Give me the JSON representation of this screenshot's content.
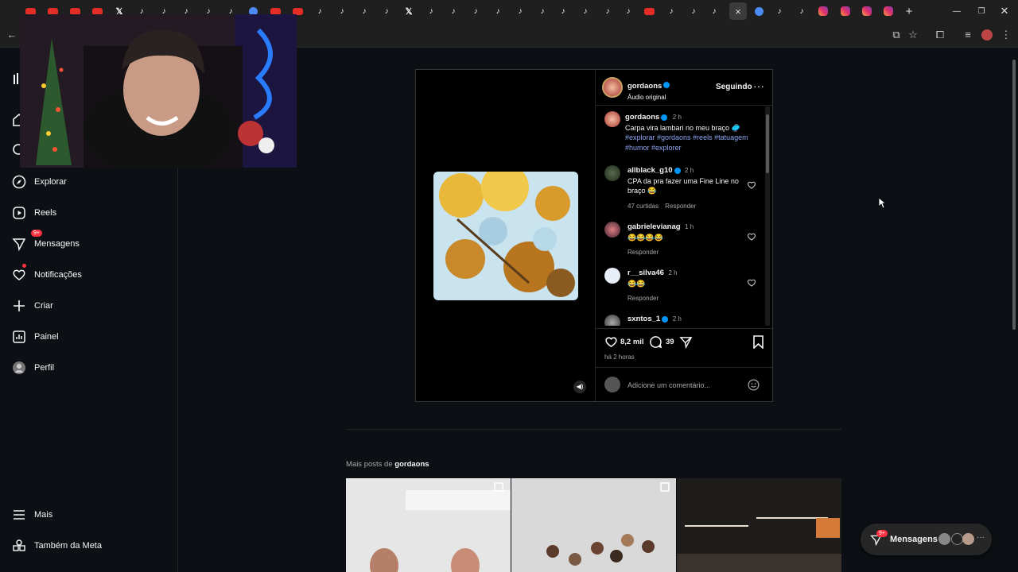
{
  "browser": {
    "active_tab_close": "×",
    "new_tab": "+"
  },
  "sidebar": {
    "items": [
      {
        "label": "Explorar",
        "icon": "compass-icon"
      },
      {
        "label": "Reels",
        "icon": "reels-icon"
      },
      {
        "label": "Mensagens",
        "icon": "messenger-icon",
        "badge": "9+"
      },
      {
        "label": "Notificações",
        "icon": "heart-icon"
      },
      {
        "label": "Criar",
        "icon": "plus-icon"
      },
      {
        "label": "Painel",
        "icon": "dashboard-icon"
      },
      {
        "label": "Perfil",
        "icon": "avatar-icon"
      }
    ],
    "more": "Mais",
    "meta": "Também da Meta"
  },
  "post": {
    "author": "gordaons",
    "audio": "Áudio original",
    "follow_state": "Seguindo",
    "caption": {
      "author": "gordaons",
      "time": "2 h",
      "text": "Carpa vira lambari no meu braço 🥏",
      "hashtags_line1": "#explorar #gordaons #reels #tatuagem",
      "hashtags_line2": "#humor #explorer"
    },
    "comments": [
      {
        "user": "allblack_g10",
        "time": "2 h",
        "text": "CPA da pra fazer uma Fine Line no braço 😂",
        "likes": "47 curtidas",
        "reply": "Responder"
      },
      {
        "user": "gabrielevianag",
        "time": "1 h",
        "text": "😂😂😂😂",
        "reply": "Responder"
      },
      {
        "user": "r__silva46",
        "time": "2 h",
        "text": "😂😂",
        "reply": "Responder"
      },
      {
        "user": "sxntos_1",
        "time": "2 h",
        "text": ""
      }
    ],
    "likes": "8,2 mil",
    "comment_count": "39",
    "posted": "há 2 horas",
    "comment_placeholder": "Adicione um comentário..."
  },
  "more_posts": {
    "prefix": "Mais posts de",
    "user": "gordaons"
  },
  "messages_pill": {
    "label": "Mensagens",
    "badge": "9+"
  },
  "colors": {
    "background": "#0c1014",
    "link": "#8fa7f3",
    "badge": "#ff3040",
    "verified": "#0095f6"
  }
}
